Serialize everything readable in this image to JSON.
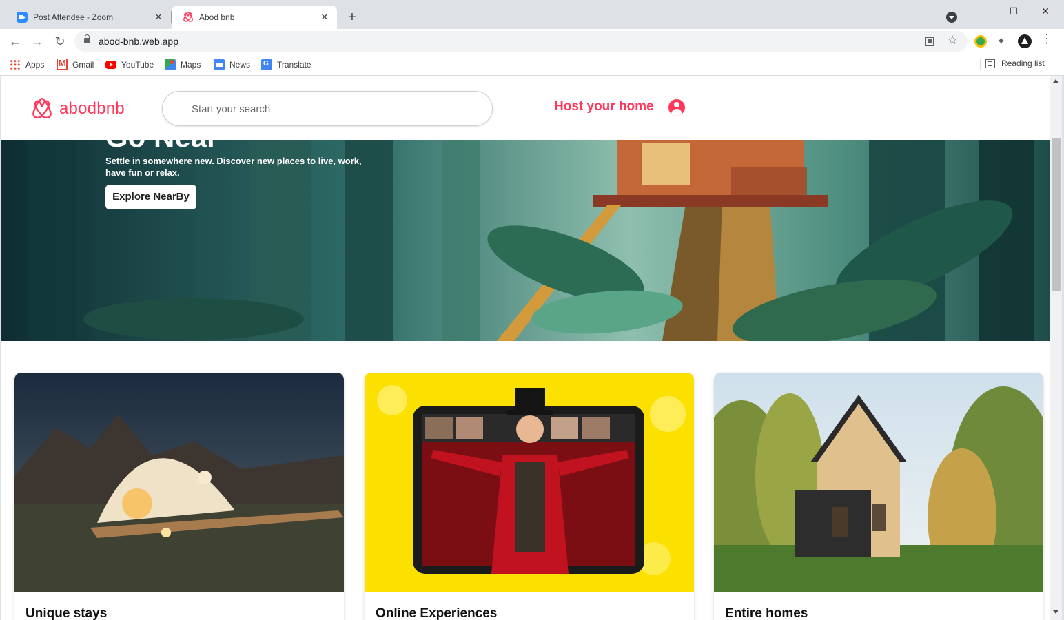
{
  "browser": {
    "tabs": [
      {
        "title": "Post Attendee - Zoom",
        "active": false,
        "favicon": "zoom-icon"
      },
      {
        "title": "Abod bnb",
        "active": true,
        "favicon": "airbnb-icon"
      }
    ],
    "url": "abod-bnb.web.app",
    "bookmarks": [
      {
        "label": "Apps",
        "icon": "apps-grid-icon"
      },
      {
        "label": "Gmail",
        "icon": "gmail-icon"
      },
      {
        "label": "YouTube",
        "icon": "youtube-icon"
      },
      {
        "label": "Maps",
        "icon": "maps-icon"
      },
      {
        "label": "News",
        "icon": "news-icon"
      },
      {
        "label": "Translate",
        "icon": "translate-icon"
      }
    ],
    "reading_list": "Reading list"
  },
  "site": {
    "brand": "abodbnb",
    "search_placeholder": "Start your search",
    "host_link": "Host your home",
    "accent_color": "#ff385c"
  },
  "hero": {
    "title": "Go Near",
    "subtitle": "Settle in somewhere new. Discover new places to live, work, have fun or relax.",
    "button": "Explore NearBy"
  },
  "cards": [
    {
      "title": "Unique stays"
    },
    {
      "title": "Online Experiences"
    },
    {
      "title": "Entire homes"
    }
  ]
}
